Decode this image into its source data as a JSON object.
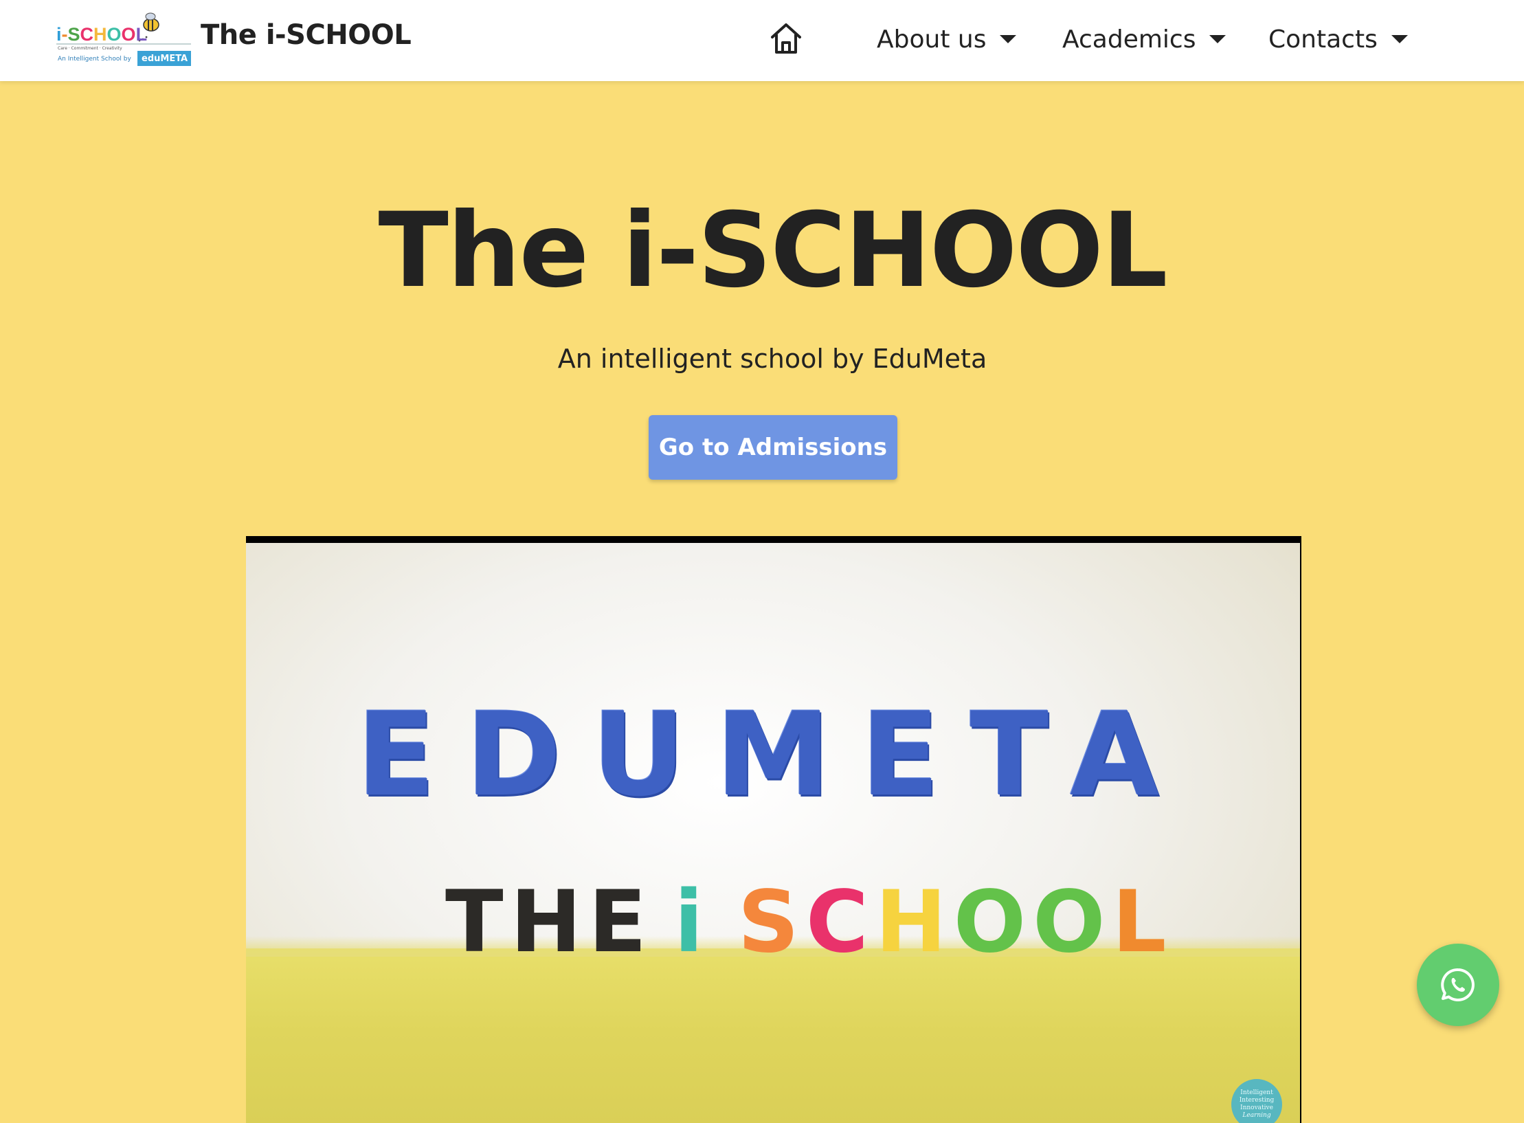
{
  "header": {
    "logo": {
      "wordmark": "i-SCHOOL",
      "tagline": "Care · Commitment · Creativity",
      "byline": "An Intelligent School by",
      "partner": "eduMETA"
    },
    "brand_title": "The i-SCHOOL",
    "nav": {
      "home_icon": "home-icon",
      "items": [
        {
          "label": "About us"
        },
        {
          "label": "Academics"
        },
        {
          "label": "Contacts"
        }
      ]
    }
  },
  "hero": {
    "title": "The i-SCHOOL",
    "subtitle": "An intelligent school by EduMeta",
    "cta_label": "Go to Admissions"
  },
  "video": {
    "line1": "EDUMETA",
    "line2": {
      "the": "THE",
      "i": "i",
      "s": "S",
      "c": "C",
      "h": "H",
      "o": "O",
      "l": "L"
    },
    "badge": [
      "Intelligent",
      "Interesting",
      "Innovative",
      "Learning"
    ]
  },
  "floating": {
    "whatsapp_icon": "whatsapp-icon"
  },
  "colors": {
    "page_background": "#fadd77",
    "header_background": "#ffffff",
    "cta_background": "#6f95e3",
    "whatsapp_green": "#62cd6f",
    "edumeta_blue": "#3e61c4"
  }
}
